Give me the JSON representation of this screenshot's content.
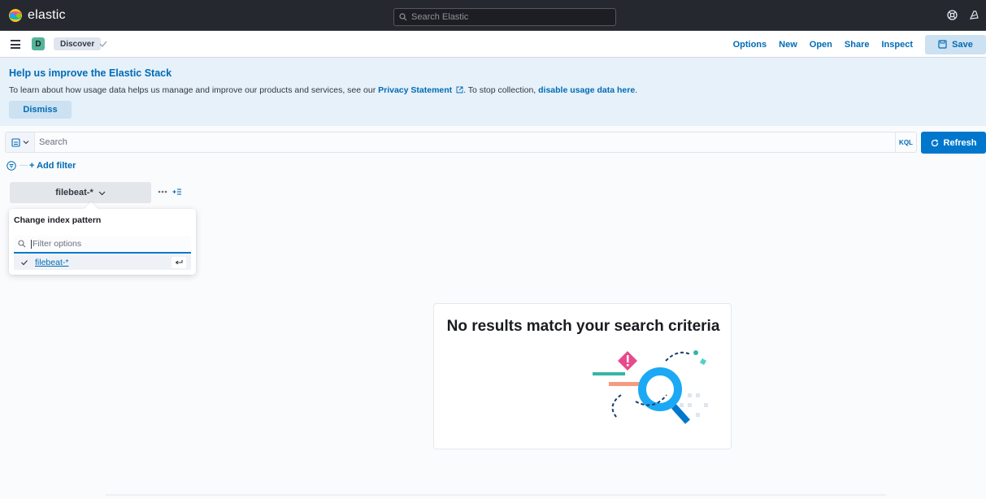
{
  "header": {
    "logo_text": "elastic",
    "search_placeholder": "Search Elastic",
    "icons": [
      "help-icon",
      "newsfeed-icon"
    ]
  },
  "appbar": {
    "space_initial": "D",
    "breadcrumb": "Discover",
    "links": [
      "Options",
      "New",
      "Open",
      "Share",
      "Inspect"
    ],
    "save_label": "Save"
  },
  "callout": {
    "title": "Help us improve the Elastic Stack",
    "text_before": "To learn about how usage data helps us manage and improve our products and services, see our ",
    "privacy_link": "Privacy Statement",
    "text_middle": ". To stop collection, ",
    "disable_link": "disable usage data here",
    "text_after": ".",
    "dismiss_label": "Dismiss"
  },
  "query": {
    "placeholder": "Search",
    "language": "KQL",
    "refresh_label": "Refresh"
  },
  "filters": {
    "add_filter_label": "+ Add filter"
  },
  "index_pattern": {
    "selected": "filebeat-*",
    "popover_title": "Change index pattern",
    "filter_placeholder": "Filter options",
    "options": [
      "filebeat-*"
    ]
  },
  "empty_state": {
    "title": "No results match your search criteria"
  },
  "colors": {
    "header_bg": "#25282f",
    "accent": "#006bb4",
    "primary_button": "#0077cc",
    "callout_bg": "#e6f1fa"
  }
}
